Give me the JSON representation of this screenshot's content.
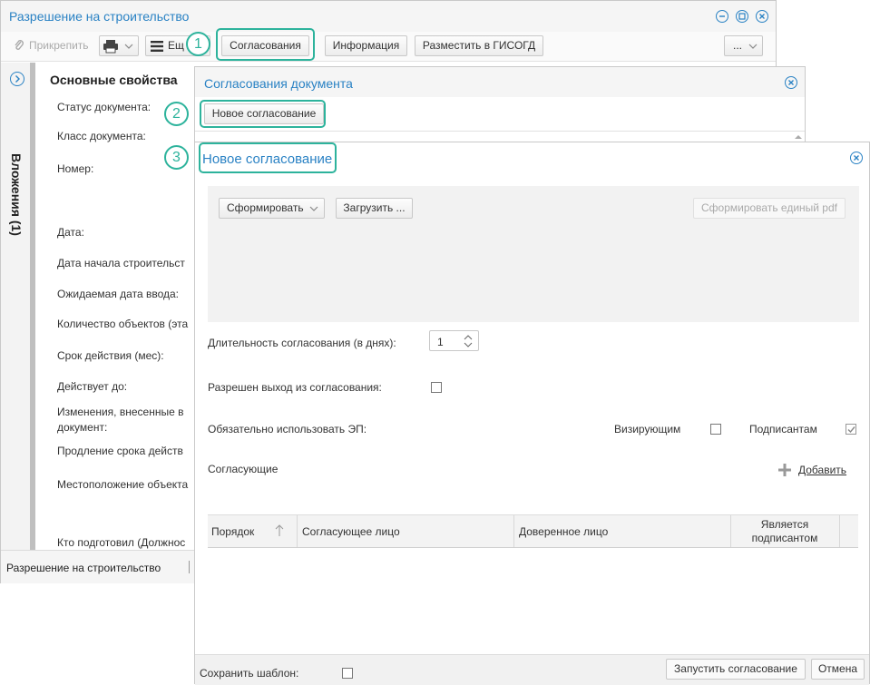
{
  "window1": {
    "title": "Разрешение на строительство",
    "toolbar": {
      "attach_label": "Прикрепить",
      "more_label": "Ещ",
      "approvals_label": "Согласования",
      "info_label": "Информация",
      "publish_label": "Разместить в ГИСОГД",
      "overflow_label": "..."
    },
    "sidebar_label": "Вложения (1)",
    "section_title": "Основные свойства",
    "fields": [
      "Статус документа:",
      "Класс документа:",
      "Номер:",
      "Дата:",
      "Дата начала строительст",
      "Ожидаемая дата ввода:",
      "Количество объектов (эта",
      "Срок действия (мес):",
      "Действует до:",
      "Изменения, внесенные в",
      "документ:",
      "Продление срока действ",
      "Местоположение объекта",
      "Кто подготовил (Должнос"
    ],
    "status_tab": "Разрешение на строительство"
  },
  "window2": {
    "title": "Согласования документа",
    "new_button": "Новое согласование"
  },
  "window3": {
    "title": "Новое согласование",
    "form_button": "Сформировать",
    "upload_button": "Загрузить ...",
    "single_pdf_button": "Сформировать единый pdf",
    "duration_label": "Длительность согласования (в днях):",
    "duration_value": "1",
    "exit_allowed_label": "Разрешен выход из согласования:",
    "es_required_label": "Обязательно использовать ЭП:",
    "approvers_label": "Визирующим",
    "signers_label": "Подписантам",
    "participants_label": "Согласующие",
    "add_label": "Добавить",
    "grid_columns": [
      "Порядок",
      "Согласующее лицо",
      "Доверенное лицо",
      "Является подписантом"
    ],
    "save_template_label": "Сохранить шаблон:",
    "start_button": "Запустить согласование",
    "cancel_button": "Отмена"
  },
  "badges": [
    "1",
    "2",
    "3"
  ],
  "colors": {
    "accent": "#2a82c4",
    "callout": "#2db39c"
  },
  "icons": [
    "paperclip-icon",
    "printer-icon",
    "menu-icon",
    "minimize-icon",
    "restore-icon",
    "close-icon",
    "expand-icon",
    "sort-up-icon",
    "plus-icon",
    "chevron-down-icon",
    "spinner-icon"
  ]
}
